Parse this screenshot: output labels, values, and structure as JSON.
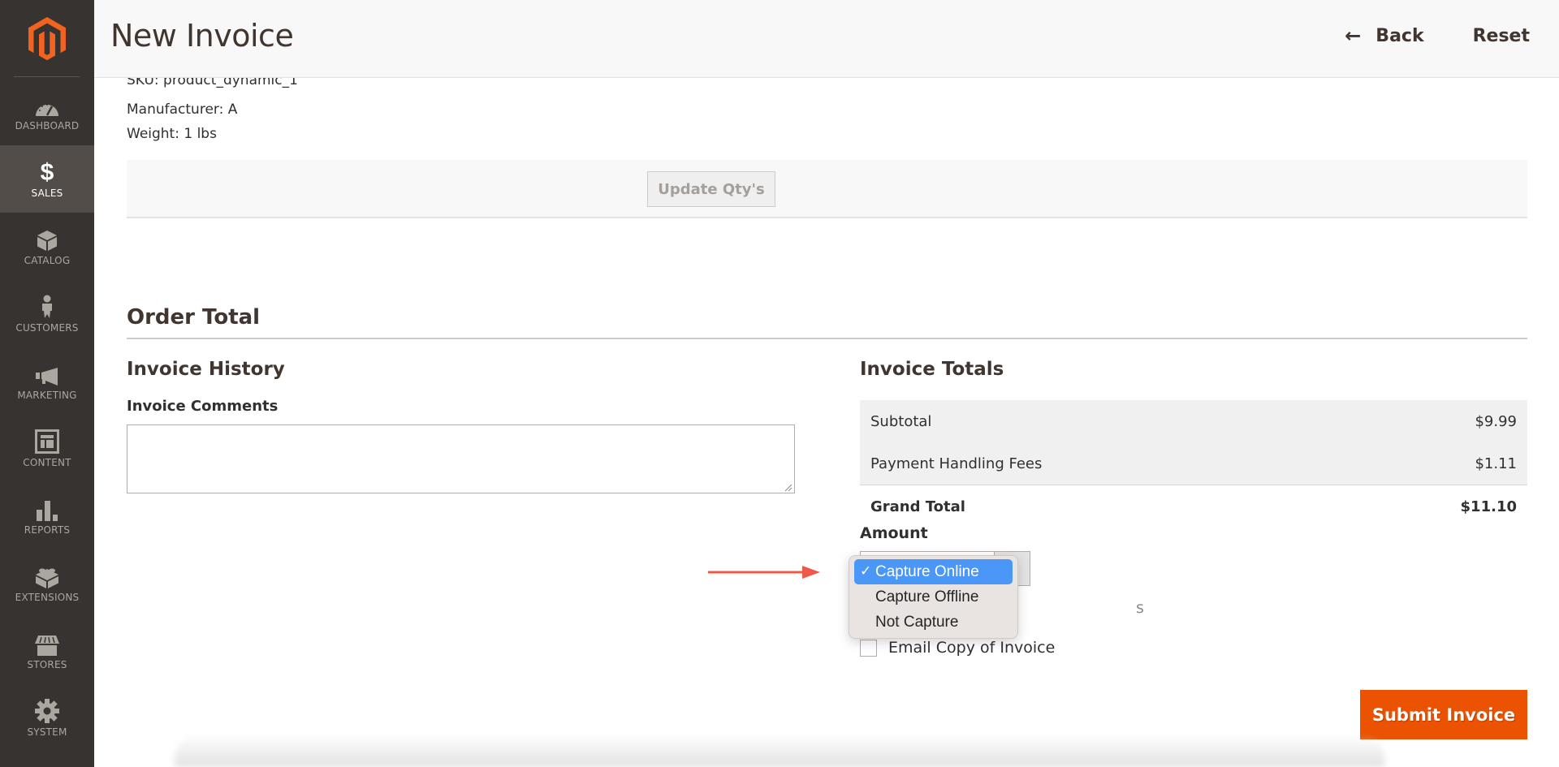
{
  "sidebar": {
    "logo": "magento-logo",
    "items": [
      {
        "label": "DASHBOARD",
        "icon": "dashboard-icon",
        "active": false
      },
      {
        "label": "SALES",
        "icon": "dollar-icon",
        "active": true
      },
      {
        "label": "CATALOG",
        "icon": "box-icon",
        "active": false
      },
      {
        "label": "CUSTOMERS",
        "icon": "person-icon",
        "active": false
      },
      {
        "label": "MARKETING",
        "icon": "megaphone-icon",
        "active": false
      },
      {
        "label": "CONTENT",
        "icon": "layout-icon",
        "active": false
      },
      {
        "label": "REPORTS",
        "icon": "bar-chart-icon",
        "active": false
      },
      {
        "label": "EXTENSIONS",
        "icon": "lego-block-icon",
        "active": false
      },
      {
        "label": "STORES",
        "icon": "storefront-icon",
        "active": false
      },
      {
        "label": "SYSTEM",
        "icon": "gear-icon",
        "active": false
      }
    ],
    "sales_symbol": "$"
  },
  "header": {
    "title": "New Invoice",
    "back_label": "Back",
    "back_icon": "arrow-left-icon",
    "back_arrow": "←",
    "reset_label": "Reset"
  },
  "product": {
    "sku_line": "SKU: product_dynamic_1",
    "manufacturer_line": "Manufacturer:  A",
    "weight_line": "Weight:  1 lbs"
  },
  "update_button_label": "Update Qty's",
  "order_total": {
    "section_title": "Order Total",
    "history": {
      "title": "Invoice History",
      "comments_label": "Invoice Comments",
      "comments_value": ""
    },
    "totals": {
      "title": "Invoice Totals",
      "rows": [
        {
          "label": "Subtotal",
          "value": "$9.99"
        },
        {
          "label": "Payment Handling Fees",
          "value": "$1.11"
        }
      ],
      "grand_total": {
        "label": "Grand Total",
        "value": "$11.10"
      }
    },
    "amount": {
      "label": "Amount",
      "selected": "Capture Online",
      "options": [
        {
          "label": "Capture Online",
          "selected": true
        },
        {
          "label": "Capture Offline",
          "selected": false
        },
        {
          "label": "Not Capture",
          "selected": false
        }
      ],
      "check_glyph": "✓",
      "obscured_text": "s"
    },
    "email_copy_label": "Email Copy of Invoice",
    "email_copy_checked": false,
    "submit_label": "Submit Invoice"
  },
  "colors": {
    "sidebar_bg": "#373330",
    "sidebar_active": "#524d49",
    "brand_orange": "#eb5202",
    "logo_orange": "#f26322",
    "dropdown_highlight": "#4a97f8",
    "annotation_arrow": "#f0584a"
  }
}
